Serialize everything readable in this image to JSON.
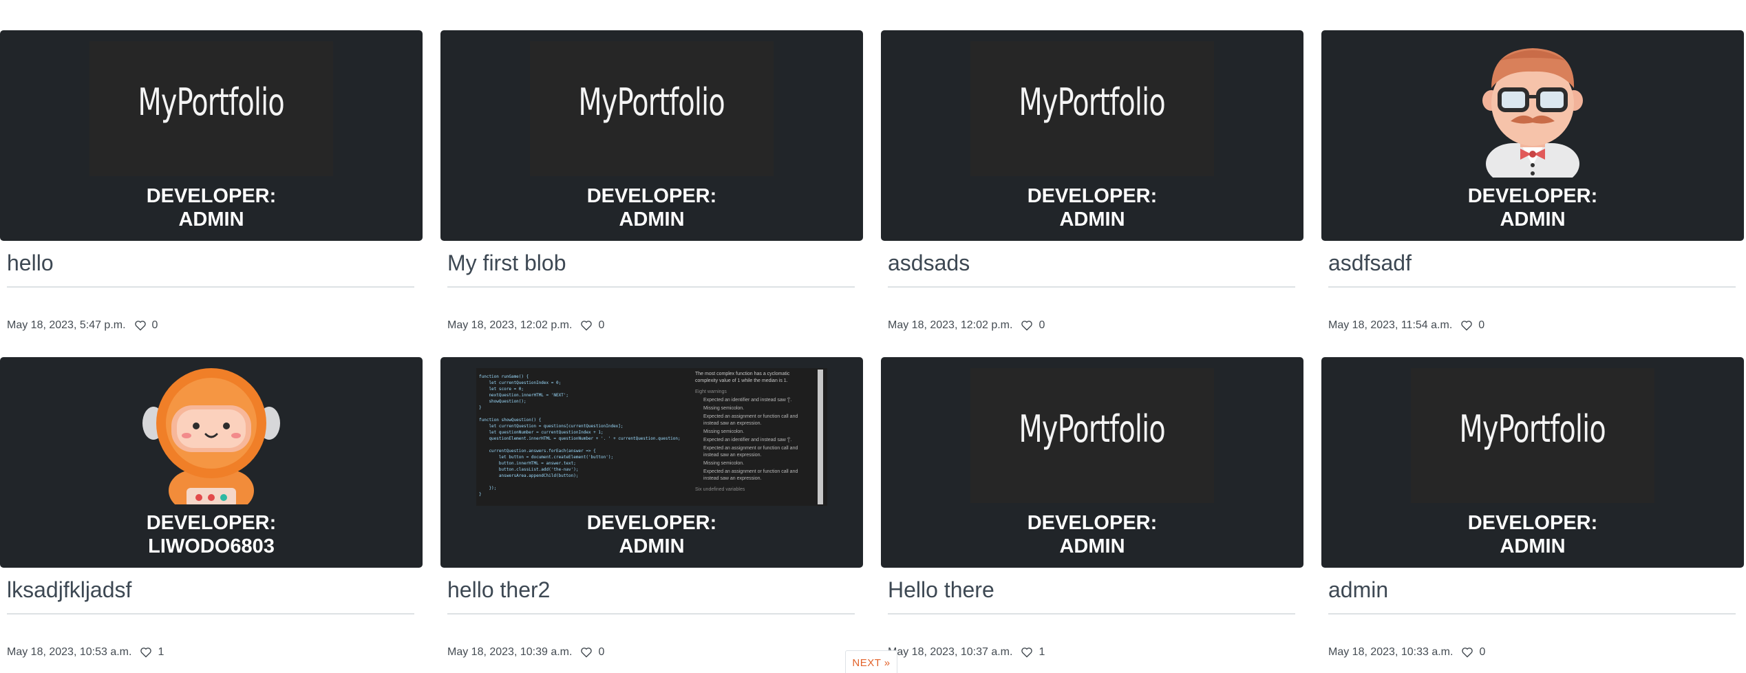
{
  "posts": [
    {
      "title": "hello",
      "developer_label": "DEVELOPER:",
      "developer": "ADMIN",
      "date": "May 18, 2023, 5:47 p.m.",
      "likes": "0",
      "thumb": "logo",
      "logo_text": "MyPortfolio"
    },
    {
      "title": "My first blob",
      "developer_label": "DEVELOPER:",
      "developer": "ADMIN",
      "date": "May 18, 2023, 12:02 p.m.",
      "likes": "0",
      "thumb": "logo",
      "logo_text": "MyPortfolio"
    },
    {
      "title": "asdsads",
      "developer_label": "DEVELOPER:",
      "developer": "ADMIN",
      "date": "May 18, 2023, 12:02 p.m.",
      "likes": "0",
      "thumb": "logo",
      "logo_text": "MyPortfolio"
    },
    {
      "title": "asdfsadf",
      "developer_label": "DEVELOPER:",
      "developer": "ADMIN",
      "date": "May 18, 2023, 11:54 a.m.",
      "likes": "0",
      "thumb": "old-man-avatar"
    },
    {
      "title": "lksadjfkljadsf",
      "developer_label": "DEVELOPER:",
      "developer": "LIWODO6803",
      "date": "May 18, 2023, 10:53 a.m.",
      "likes": "1",
      "thumb": "astronaut-avatar"
    },
    {
      "title": "hello ther2",
      "developer_label": "DEVELOPER:",
      "developer": "ADMIN",
      "date": "May 18, 2023, 10:39 a.m.",
      "likes": "0",
      "thumb": "code-screenshot"
    },
    {
      "title": "Hello there",
      "developer_label": "DEVELOPER:",
      "developer": "ADMIN",
      "date": "May 18, 2023, 10:37 a.m.",
      "likes": "1",
      "thumb": "logo",
      "logo_text": "MyPortfolio"
    },
    {
      "title": "admin",
      "developer_label": "DEVELOPER:",
      "developer": "ADMIN",
      "date": "May 18, 2023, 10:33 a.m.",
      "likes": "0",
      "thumb": "logo",
      "logo_text": "MyPortfolio"
    }
  ],
  "code_screenshot": {
    "code": "function runGame() {\n    let currentQuestionIndex = 0;\n    let score = 0;\n    nextQuestion.innerHTML = 'NEXT';\n    showQuestion();\n}\n\nfunction showQuestion() {\n    let currentQuestion = questions[currentQuestionIndex];\n    let questionNumber = currentQuestionIndex + 1;\n    questionElement.innerHTML = questionNumber + '. ' + currentQuestion.question;\n\n    currentQuestion.answers.forEach(answer => {\n        let button = document.createElement('button');\n        button.innerHTML = answer.text;\n        button.classList.add('the-nav');\n        answersArea.appendChild(button);\n\n    });\n}",
    "summary": "The most complex function has a cyclomatic complexity value of 1 while the median is 1.",
    "warnings_head": "Eight warnings",
    "warnings": [
      "Expected an identifier and instead saw '['.",
      "Missing semicolon.",
      "Expected an assignment or function call and instead saw an expression.",
      "Missing semicolon.",
      "Expected an identifier and instead saw '['.",
      "Expected an assignment or function call and instead saw an expression.",
      "Missing semicolon.",
      "Expected an assignment or function call and instead saw an expression."
    ],
    "footer": "Six undefined variables"
  },
  "pagination": {
    "next_label": "NEXT »"
  },
  "colors": {
    "card_bg": "#212529",
    "title": "#3d4853",
    "accent": "#e2622a"
  },
  "icons": {
    "like": "heart-outline-icon"
  }
}
